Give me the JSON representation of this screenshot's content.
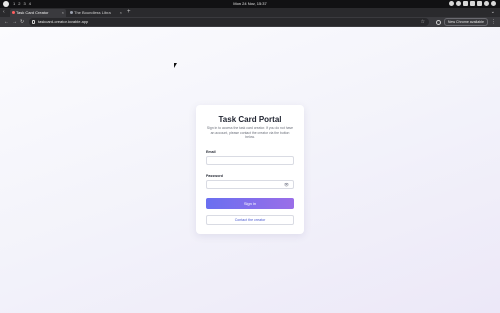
{
  "os": {
    "workspaces": [
      "1",
      "2",
      "3",
      "4"
    ],
    "clock": "Mon 24 Nov, 15:37"
  },
  "browser": {
    "tabs": [
      {
        "title": "Task Card Creator",
        "active": true
      },
      {
        "title": "The Boundless Libra",
        "active": false
      }
    ],
    "url": "taskcard-creator.lovable.app",
    "update_label": "New Chrome available"
  },
  "login": {
    "title": "Task Card Portal",
    "subtitle": "Sign in to access the task card creator. If you do not have an account, please contact the creator via the button below.",
    "email_label": "Email",
    "email_value": "",
    "password_label": "Password",
    "password_value": "",
    "signin_label": "Sign in",
    "contact_label": "Contact the creator"
  },
  "colors": {
    "accent_start": "#6a6ff0",
    "accent_end": "#9a6ee8",
    "link": "#4a5ad0"
  },
  "icons": [
    "browser-logo-icon",
    "close-icon",
    "back-icon",
    "forward-icon",
    "reload-icon",
    "lock-icon",
    "star-icon",
    "extension-icon",
    "kebab-menu-icon",
    "eye-icon"
  ]
}
